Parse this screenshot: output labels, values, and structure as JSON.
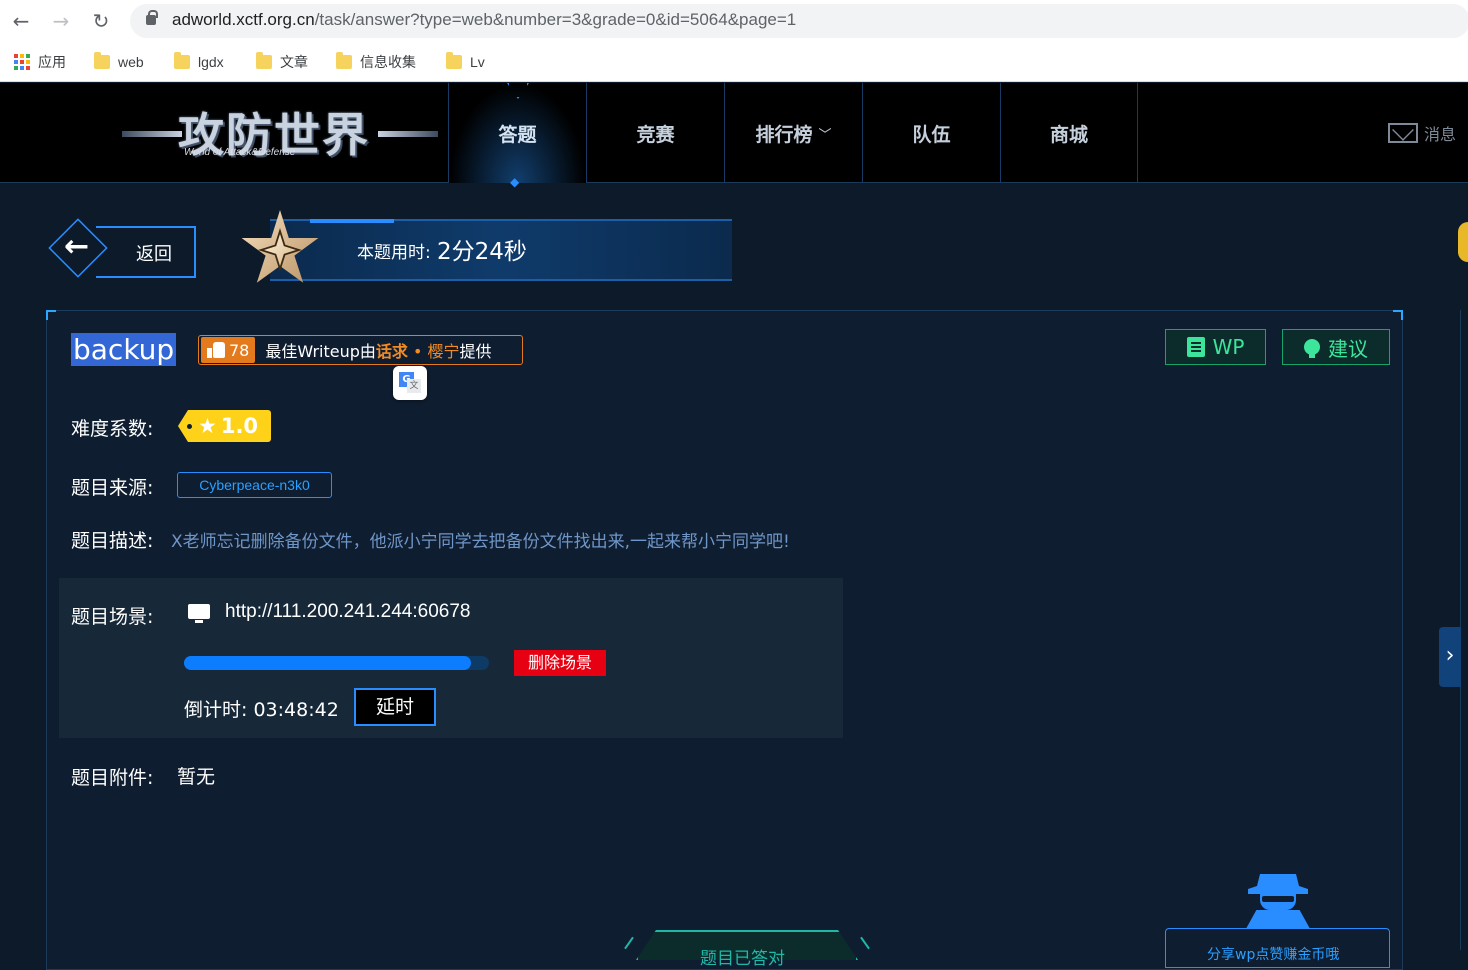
{
  "browser": {
    "url_host": "adworld.xctf.org.cn",
    "url_path": "/task/answer?type=web&number=3&grade=0&id=5064&page=1",
    "bookmarks": [
      {
        "label": "应用",
        "icon": "apps-grid-icon"
      },
      {
        "label": "web",
        "icon": "folder-icon"
      },
      {
        "label": "lgdx",
        "icon": "folder-icon"
      },
      {
        "label": "文章",
        "icon": "folder-icon"
      },
      {
        "label": "信息收集",
        "icon": "folder-icon"
      },
      {
        "label": "Lv",
        "icon": "folder-icon"
      }
    ]
  },
  "site": {
    "logo_title": "攻防世界",
    "logo_subtitle": "World of Attack&Defense",
    "nav": [
      {
        "label": "答题",
        "active": true
      },
      {
        "label": "竞赛",
        "active": false
      },
      {
        "label": "排行榜",
        "active": false,
        "has_dropdown": true
      },
      {
        "label": "队伍",
        "active": false
      },
      {
        "label": "商城",
        "active": false
      }
    ],
    "messages_label": "消息"
  },
  "task_header": {
    "back_label": "返回",
    "timer_label": "本题用时:",
    "timer_value": "2分24秒"
  },
  "task": {
    "title": "backup",
    "likes": "78",
    "writeup_prefix": "最佳Writeup由",
    "writeup_author1": "话求",
    "writeup_sep": " • ",
    "writeup_author2": "樱宁",
    "writeup_suffix": "提供",
    "wp_button": "WP",
    "suggest_button": "建议",
    "difficulty_label": "难度系数:",
    "difficulty_value": "1.0",
    "source_label": "题目来源:",
    "source_value": "Cyberpeace-n3k0",
    "desc_label": "题目描述:",
    "desc_value": "X老师忘记删除备份文件，他派小宁同学去把备份文件找出来,一起来帮小宁同学吧!",
    "scene_label": "题目场景:",
    "scene_url": "http://111.200.241.244:60678",
    "scene_progress": 0.94,
    "delete_scene": "删除场景",
    "countdown_label": "倒计时:",
    "countdown_value": "03:48:42",
    "extend_button": "延时",
    "attachment_label": "题目附件:",
    "attachment_value": "暂无",
    "answered_label": "题目已答对",
    "share_label": "分享wp点赞赚金币哦"
  },
  "colors": {
    "accent_blue": "#2a8dff",
    "green": "#3ce59b",
    "orange": "#e47a1e",
    "red": "#e60012",
    "gold": "#ffd21a"
  }
}
